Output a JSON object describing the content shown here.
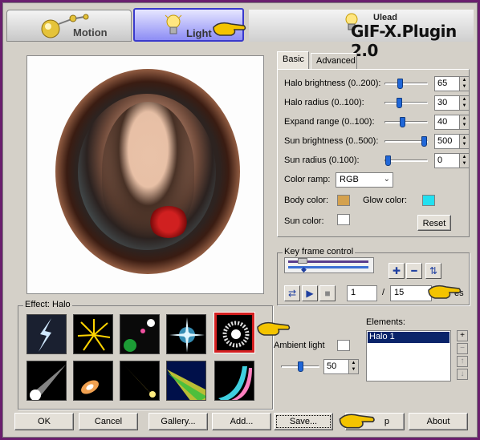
{
  "header": {
    "tab_motion": "Motion",
    "tab_light": "Light",
    "brand_vendor": "Ulead",
    "brand_title": "GIF-X.Plugin 2.0"
  },
  "tabs": {
    "basic": "Basic",
    "advanced": "Advanced"
  },
  "params": [
    {
      "label": "Halo brightness (0..200):",
      "value": "65",
      "fraction": 0.33
    },
    {
      "label": "Halo radius (0..100):",
      "value": "30",
      "fraction": 0.3
    },
    {
      "label": "Expand range (0..100):",
      "value": "40",
      "fraction": 0.4
    },
    {
      "label": "Sun brightness (0..500):",
      "value": "500",
      "fraction": 1.0
    },
    {
      "label": "Sun radius (0.100):",
      "value": "0",
      "fraction": 0.0
    }
  ],
  "color_ramp": {
    "label": "Color ramp:",
    "value": "RGB"
  },
  "body_color": {
    "label": "Body color:",
    "color": "#d4a14e"
  },
  "glow_color": {
    "label": "Glow color:",
    "color": "#22e0f0"
  },
  "sun_color": {
    "label": "Sun color:",
    "color": "#ffffff"
  },
  "reset_label": "Reset",
  "keyframe": {
    "title": "Key frame control",
    "current_frame": "1",
    "separator": "/",
    "total_frames": "15",
    "frames_label": "es"
  },
  "effects": {
    "title": "Effect: Halo",
    "items": [
      "lightning",
      "fireworks",
      "lens flare",
      "star burst",
      "halo",
      "spotlight",
      "glow",
      "comet",
      "rays",
      "rainbow"
    ]
  },
  "ambient": {
    "label": "Ambient light",
    "value": "50",
    "fraction": 0.5
  },
  "elements": {
    "title": "Elements:",
    "items": [
      "Halo 1"
    ]
  },
  "buttons": {
    "ok": "OK",
    "cancel": "Cancel",
    "gallery": "Gallery...",
    "add": "Add...",
    "save": "Save...",
    "help": "p",
    "about": "About"
  },
  "colors": {
    "window": "#d4d0c8",
    "border": "#6a1f6e",
    "accent": "#2067d8",
    "selection": "#0a246a",
    "effect_highlight": "#d42020"
  }
}
